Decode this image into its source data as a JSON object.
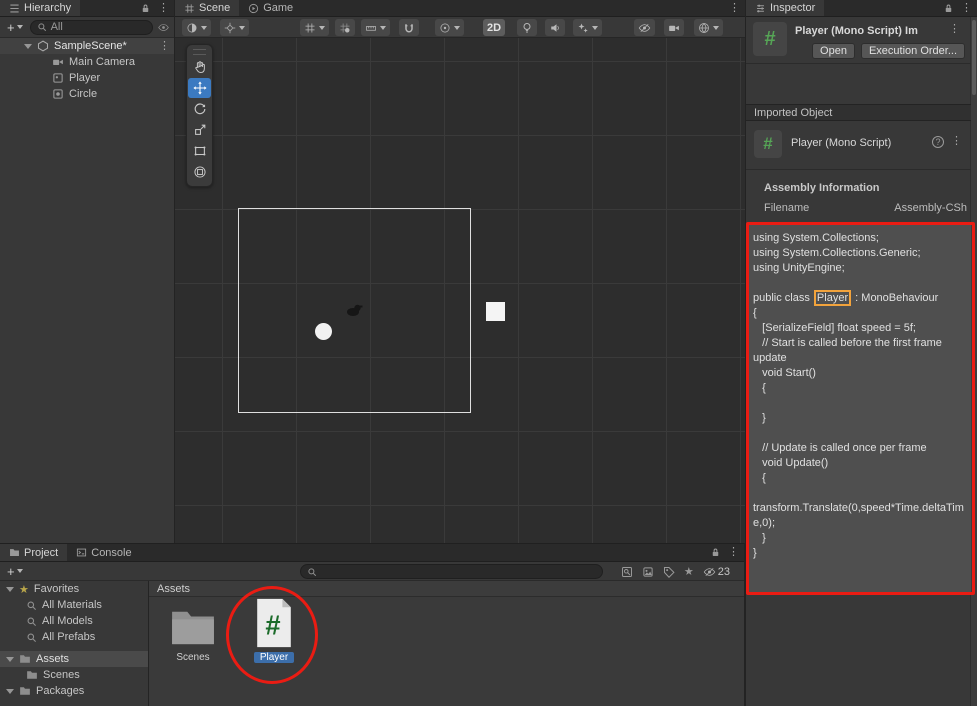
{
  "icons": {
    "kebab": "⋮",
    "help": "?",
    "star": "★"
  },
  "hierarchy": {
    "tab_title": "Hierarchy",
    "create_button": "+",
    "search_value": "All",
    "scene_row": {
      "name": "SampleScene*"
    },
    "items": [
      {
        "label": "Main Camera"
      },
      {
        "label": "Player"
      },
      {
        "label": "Circle"
      }
    ]
  },
  "scene_view": {
    "scene_tab": "Scene",
    "game_tab": "Game",
    "toolbar": {
      "two_d_label": "2D"
    }
  },
  "inspector": {
    "tab_title": "Inspector",
    "header": {
      "title": "Player (Mono Script) Im",
      "open_button": "Open",
      "execution_order_button": "Execution Order..."
    },
    "imported_object_label": "Imported Object",
    "script_section_title": "Player (Mono Script)",
    "assembly_header": "Assembly Information",
    "filename_label": "Filename",
    "filename_value": "Assembly-CSh",
    "code": {
      "lines_top": [
        "using System.Collections;",
        "using System.Collections.Generic;",
        "using UnityEngine;",
        ""
      ],
      "class_line": {
        "prefix": "public class ",
        "highlight": "Player",
        "suffix": " : MonoBehaviour"
      },
      "lines_bottom": [
        "{",
        "   [SerializeField] float speed = 5f;",
        "   // Start is called before the first frame update",
        "   void Start()",
        "   {",
        "",
        "   }",
        "",
        "   // Update is called once per frame",
        "   void Update()",
        "   {",
        "",
        "transform.Translate(0,speed*Time.deltaTime,0);",
        "   }",
        "}"
      ]
    }
  },
  "project": {
    "project_tab": "Project",
    "console_tab": "Console",
    "create_button": "+",
    "hidden_count": "23",
    "favorites_label": "Favorites",
    "favorites": [
      {
        "label": "All Materials"
      },
      {
        "label": "All Models"
      },
      {
        "label": "All Prefabs"
      }
    ],
    "assets_label": "Assets",
    "scenes_label": "Scenes",
    "packages_label": "Packages",
    "breadcrumb": "Assets",
    "items": [
      {
        "label": "Scenes",
        "type": "folder"
      },
      {
        "label": "Player",
        "type": "csharp-script"
      }
    ]
  }
}
